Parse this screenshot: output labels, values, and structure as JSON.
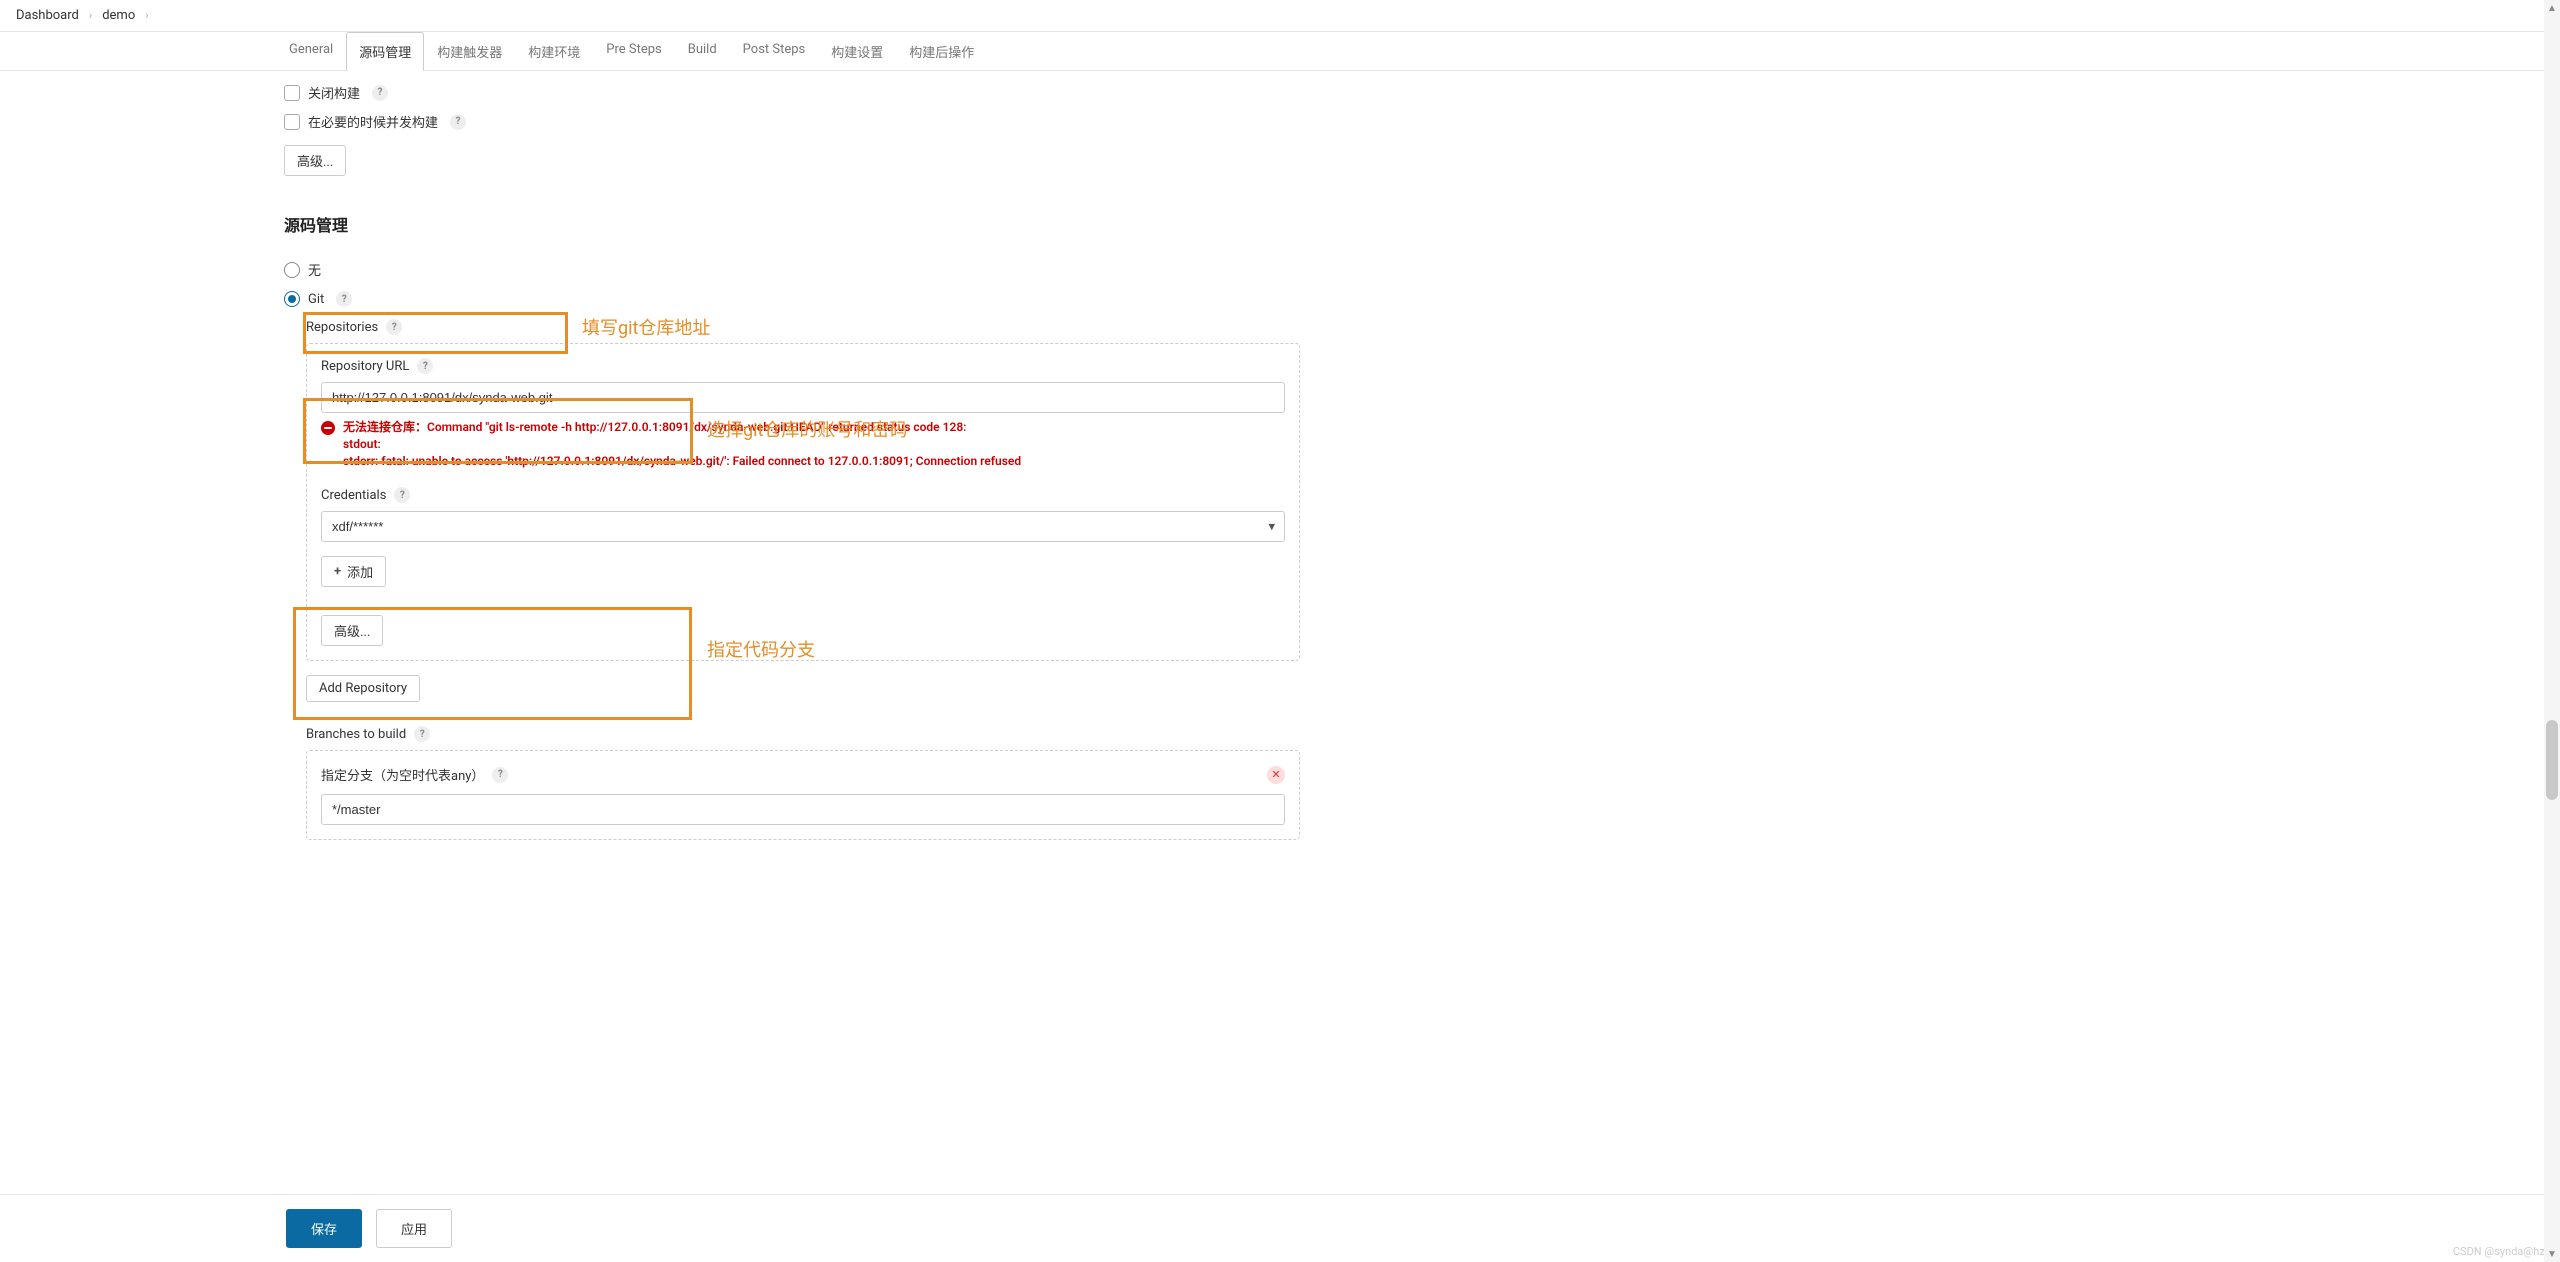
{
  "breadcrumb": {
    "root": "Dashboard",
    "project": "demo"
  },
  "tabs": [
    {
      "id": "general",
      "label": "General"
    },
    {
      "id": "scm",
      "label": "源码管理"
    },
    {
      "id": "triggers",
      "label": "构建触发器"
    },
    {
      "id": "env",
      "label": "构建环境"
    },
    {
      "id": "presteps",
      "label": "Pre Steps"
    },
    {
      "id": "build",
      "label": "Build"
    },
    {
      "id": "poststeps",
      "label": "Post Steps"
    },
    {
      "id": "settings",
      "label": "构建设置"
    },
    {
      "id": "postactions",
      "label": "构建后操作"
    }
  ],
  "general_opts": {
    "disable_build": "关闭构建",
    "concurrent_build": "在必要的时候并发构建",
    "advanced_btn": "高级..."
  },
  "scm": {
    "title": "源码管理",
    "none_label": "无",
    "git_label": "Git",
    "repositories_label": "Repositories",
    "repo_url_label": "Repository URL",
    "repo_url_value": "http://127.0.0.1:8091/dx/synda-web.git",
    "error_line1": "无法连接仓库：Command \"git ls-remote -h http://127.0.0.1:8091/dx/synda-web.git HEAD\" returned status code 128:",
    "error_line2": "stdout:",
    "error_line3": "stderr: fatal: unable to access 'http://127.0.0.1:8091/dx/synda-web.git/': Failed connect to 127.0.0.1:8091; Connection refused",
    "credentials_label": "Credentials",
    "credentials_value": "xdf/******",
    "add_btn": "添加",
    "advanced_btn": "高级...",
    "add_repo_btn": "Add Repository",
    "branches_label": "Branches to build",
    "branch_spec_label": "指定分支（为空时代表any）",
    "branch_spec_value": "*/master"
  },
  "annotations": {
    "a1": "填写git仓库地址",
    "a2": "选择git仓库的账号和密码",
    "a3": "指定代码分支"
  },
  "footer": {
    "save": "保存",
    "apply": "应用"
  },
  "watermark": "CSDN @synda@hzy"
}
